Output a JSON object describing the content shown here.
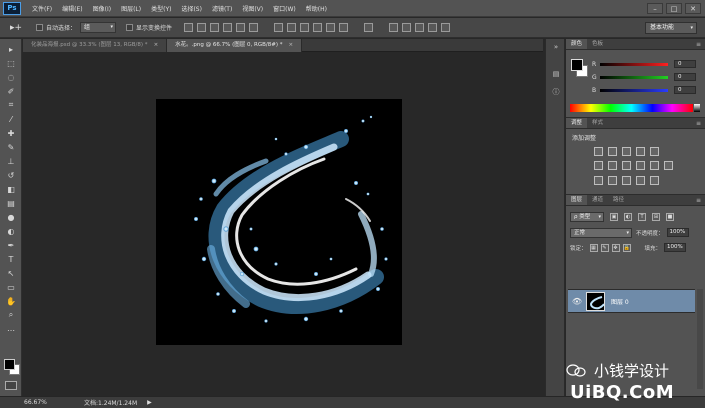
{
  "app": {
    "logo": "Ps",
    "menus": [
      "文件(F)",
      "编辑(E)",
      "图像(I)",
      "图层(L)",
      "类型(Y)",
      "选择(S)",
      "滤镜(T)",
      "视图(V)",
      "窗口(W)",
      "帮助(H)"
    ],
    "window_controls": [
      "–",
      "□",
      "✕"
    ]
  },
  "options_bar": {
    "tool_glyph": "▸+",
    "auto_select_label": "自动选择：",
    "auto_select_value": "组",
    "show_transform_label": "显示变换控件",
    "workspace": "基本功能"
  },
  "document_tabs": [
    {
      "title": "化装品海报.psd @ 33.3% (图层 13, RGB/8) *",
      "close": "×"
    },
    {
      "title": "水花。.png @ 66.7% (图层 0, RGB/8#) *",
      "close": "×"
    }
  ],
  "panels": {
    "color": {
      "tabs": [
        "颜色",
        "色板"
      ],
      "menu_glyph": "≡",
      "sliders": [
        {
          "letter": "R",
          "value": "0",
          "color": "#ff2020"
        },
        {
          "letter": "G",
          "value": "0",
          "color": "#22d022"
        },
        {
          "letter": "B",
          "value": "0",
          "color": "#2a3cff"
        }
      ]
    },
    "adjustments": {
      "tabs": [
        "调整",
        "样式"
      ],
      "menu_glyph": "≡",
      "title": "添加调整"
    },
    "layers": {
      "tabs": [
        "图层",
        "通道",
        "路径"
      ],
      "menu_glyph": "≡",
      "filter_kind": "ρ 类型",
      "blend_mode": "正常",
      "opacity_label": "不透明度：",
      "opacity_value": "100%",
      "lock_label": "锁定：",
      "fill_label": "填充：",
      "fill_value": "100%",
      "filter_icons": [
        "▣",
        "◐",
        "T",
        "⊞",
        "■"
      ],
      "lock_icons": [
        "▦",
        "✎",
        "✥",
        "🔒"
      ],
      "layer_name": "图层 0",
      "eye_glyph": "👁"
    }
  },
  "status_bar": {
    "zoom": "66.67%",
    "doc_info": "文档:1.24M/1.24M",
    "arrow": "▶"
  },
  "watermark": {
    "line1": "小钱学设计",
    "line2": "UiBQ.CoM"
  },
  "colors": {
    "accent": "#4fb4ff",
    "layer_highlight": "#6f8ba9",
    "canvas_bg": "#000000",
    "workspace_bg": "#282828"
  }
}
